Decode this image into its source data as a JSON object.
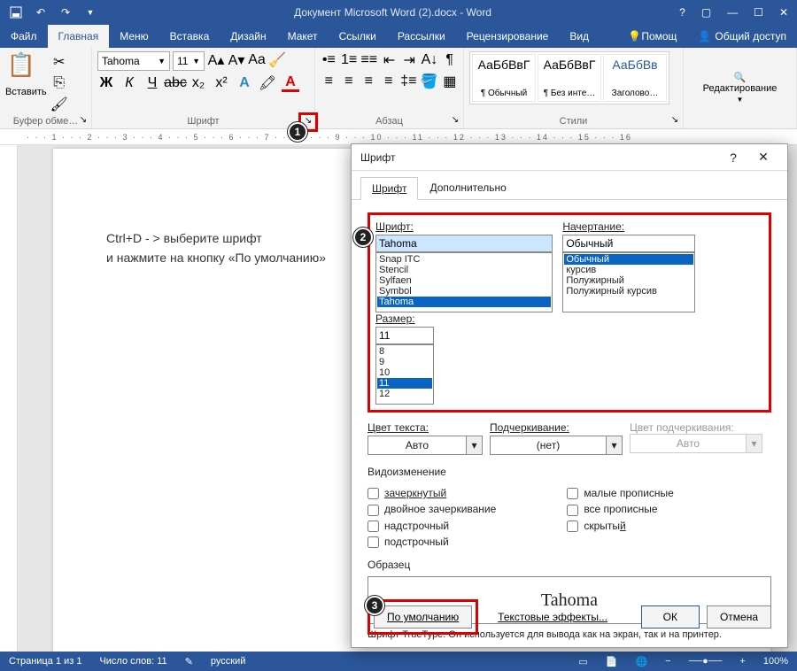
{
  "title": "Документ Microsoft Word (2).docx - Word",
  "tabs": {
    "file": "Файл",
    "home": "Главная",
    "menu": "Меню",
    "insert": "Вставка",
    "design": "Дизайн",
    "layout": "Макет",
    "refs": "Ссылки",
    "mail": "Рассылки",
    "review": "Рецензирование",
    "view": "Вид",
    "help": "Помощ",
    "share": "Общий доступ"
  },
  "ribbon": {
    "clipboard": {
      "paste": "Вставить",
      "label": "Буфер обме…"
    },
    "font": {
      "name": "Tahoma",
      "size": "11",
      "label": "Шрифт"
    },
    "paragraph": {
      "label": "Абзац"
    },
    "styles": {
      "label": "Стили",
      "s1": "АаБбВвГ",
      "s2": "АаБбВвГ",
      "s3": "АаБбВв",
      "n1": "¶ Обычный",
      "n2": "¶ Без инте…",
      "n3": "Заголово…"
    },
    "editing": {
      "label": "Редактирование"
    }
  },
  "document": {
    "line1": "Ctrl+D - > выберите шрифт",
    "line2": "и нажмите на кнопку «По умолчанию»"
  },
  "status": {
    "page": "Страница 1 из 1",
    "words": "Число слов: 11",
    "lang": "русский",
    "zoom": "100%"
  },
  "dialog": {
    "title": "Шрифт",
    "tab_font": "Шрифт",
    "tab_adv": "Дополнительно",
    "lbl_font": "Шрифт:",
    "lbl_style": "Начертание:",
    "lbl_size": "Размер:",
    "font_value": "Tahoma",
    "font_list": [
      "Snap ITC",
      "Stencil",
      "Sylfaen",
      "Symbol",
      "Tahoma"
    ],
    "style_value": "Обычный",
    "style_list": [
      "Обычный",
      "курсив",
      "Полужирный",
      "Полужирный курсив"
    ],
    "size_value": "11",
    "size_list": [
      "8",
      "9",
      "10",
      "11",
      "12"
    ],
    "lbl_color": "Цвет текста:",
    "color_val": "Авто",
    "lbl_underline": "Подчеркивание:",
    "underline_val": "(нет)",
    "lbl_ucolor": "Цвет подчеркивания:",
    "ucolor_val": "Авто",
    "effects": "Видоизменение",
    "chk_strike": "зачеркнутый",
    "chk_dstrike": "двойное зачеркивание",
    "chk_super": "надстрочный",
    "chk_sub": "подстрочный",
    "chk_smallcaps": "малые прописные",
    "chk_allcaps": "все прописные",
    "chk_hidden": "скрытый",
    "lbl_sample": "Образец",
    "sample": "Tahoma",
    "hint": "Шрифт TrueType. Он используется для вывода как на экран, так и на принтер.",
    "btn_default": "По умолчанию",
    "btn_effects": "Текстовые эффекты...",
    "btn_ok": "ОК",
    "btn_cancel": "Отмена"
  }
}
